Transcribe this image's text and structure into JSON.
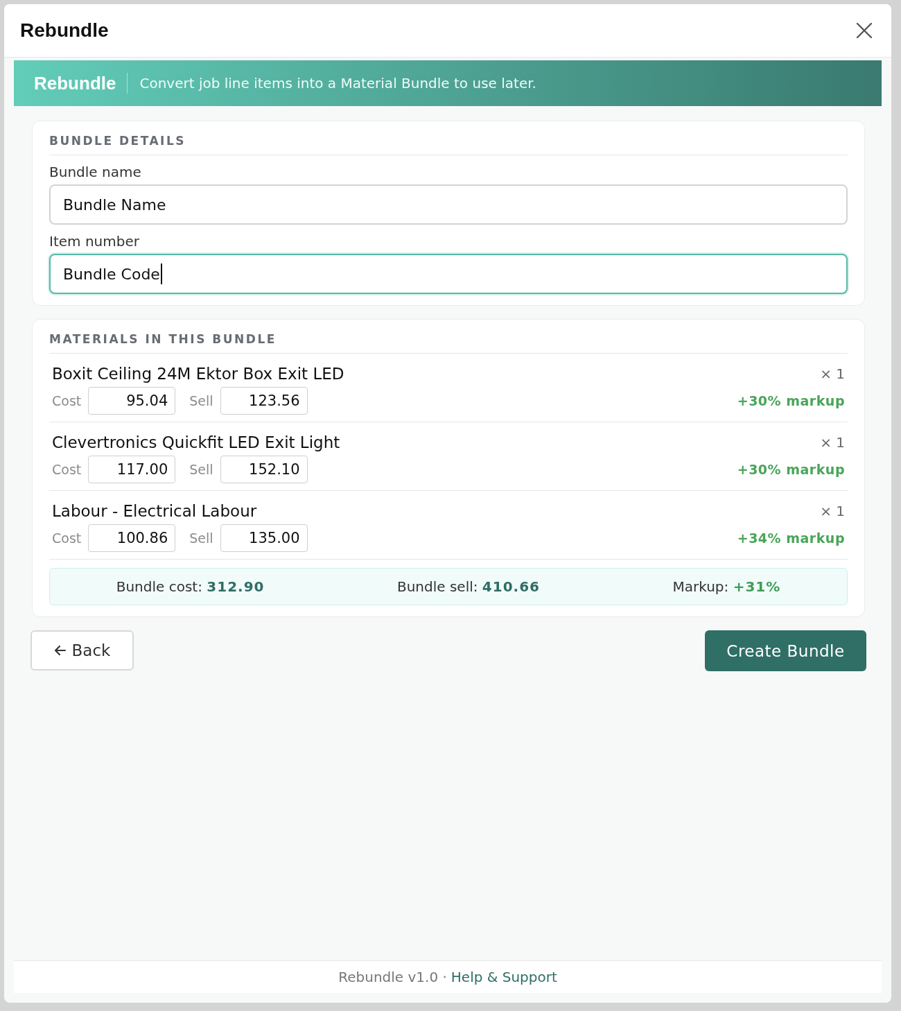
{
  "dialog": {
    "title": "Rebundle"
  },
  "banner": {
    "title": "Rebundle",
    "subtitle": "Convert job line items into a Material Bundle to use later."
  },
  "details": {
    "heading": "BUNDLE DETAILS",
    "fields": [
      {
        "label": "Bundle name",
        "value": "Bundle Name",
        "focused": false
      },
      {
        "label": "Item number",
        "value": "Bundle Code",
        "focused": true
      }
    ]
  },
  "materials": {
    "heading": "MATERIALS IN THIS BUNDLE",
    "items": [
      {
        "name": "Boxit Ceiling 24M Ektor Box Exit LED",
        "quantity": "× 1",
        "cost_label": "Cost",
        "cost": "95.04",
        "sell_label": "Sell",
        "sell": "123.56",
        "markup": "+30% markup"
      },
      {
        "name": "Clevertronics Quickfit LED Exit Light",
        "quantity": "× 1",
        "cost_label": "Cost",
        "cost": "117.00",
        "sell_label": "Sell",
        "sell": "152.10",
        "markup": "+30% markup"
      },
      {
        "name": "Labour - Electrical Labour",
        "quantity": "× 1",
        "cost_label": "Cost",
        "cost": "100.86",
        "sell_label": "Sell",
        "sell": "135.00",
        "markup": "+34% markup"
      }
    ],
    "summary": [
      {
        "label": "Bundle cost:",
        "value": "312.90",
        "kind": "amount"
      },
      {
        "label": "Bundle sell:",
        "value": "410.66",
        "kind": "amount"
      },
      {
        "label": "Markup:",
        "value": "+31%",
        "kind": "markup"
      }
    ]
  },
  "buttons": {
    "back": "Back",
    "create": "Create Bundle"
  },
  "footer": {
    "version": "Rebundle v1.0 ·",
    "link": "Help & Support"
  }
}
